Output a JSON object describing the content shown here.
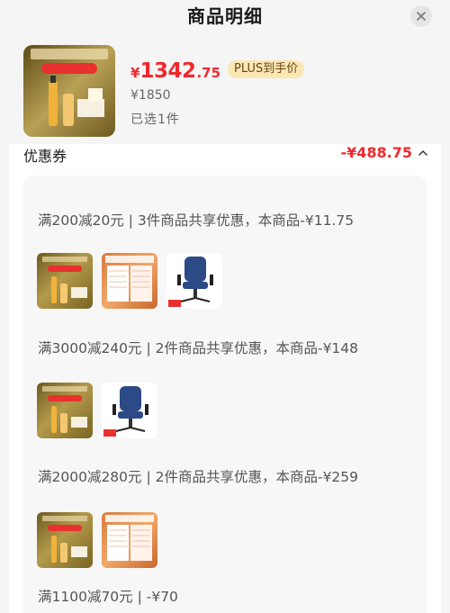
{
  "header": {
    "title": "商品明细",
    "close_icon": "close-icon"
  },
  "product": {
    "price_symbol": "¥",
    "price_int": "1342",
    "price_dec": ".75",
    "plus_label": "PLUS到手价",
    "original_price": "¥1850",
    "selected_label": "已选1件"
  },
  "coupon": {
    "title": "优惠券",
    "amount": "-¥488.75",
    "rules": [
      {
        "text": "满200减20元 | 3件商品共享优惠，本商品-¥11.75",
        "thumbs": [
          "serum",
          "paper",
          "chair"
        ]
      },
      {
        "text": "满3000减240元 | 2件商品共享优惠，本商品-¥148",
        "thumbs": [
          "serum",
          "chair"
        ]
      },
      {
        "text": "满2000减280元 | 2件商品共享优惠，本商品-¥259",
        "thumbs": [
          "serum",
          "paper"
        ]
      },
      {
        "text": "满1100减70元 | -¥70",
        "thumbs": []
      }
    ]
  },
  "colors": {
    "accent_red": "#f0282d",
    "plus_bg": "#fbe7b4"
  }
}
